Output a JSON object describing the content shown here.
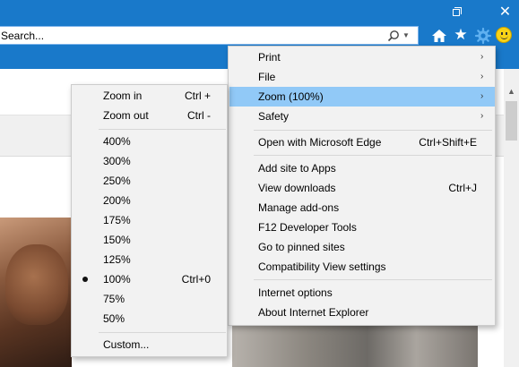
{
  "window": {
    "close_glyph": "✕"
  },
  "address_bar": {
    "value": "Search...",
    "dropdown_glyph": "▼"
  },
  "toolbar": {
    "favorites_glyph": "★",
    "icons": [
      "home-icon",
      "favorites-star-icon",
      "tools-gear-icon",
      "feedback-smiley-icon"
    ]
  },
  "scrollbar": {
    "up_glyph": "▲"
  },
  "tools_menu": {
    "arrow_glyph": "›",
    "items": [
      {
        "label": "Print",
        "shortcut": "",
        "submenu": true
      },
      {
        "label": "File",
        "shortcut": "",
        "submenu": true
      },
      {
        "label": "Zoom (100%)",
        "shortcut": "",
        "submenu": true,
        "highlighted": true
      },
      {
        "label": "Safety",
        "shortcut": "",
        "submenu": true
      },
      {
        "label": "Open with Microsoft Edge",
        "shortcut": "Ctrl+Shift+E"
      },
      {
        "label": "Add site to Apps",
        "shortcut": ""
      },
      {
        "label": "View downloads",
        "shortcut": "Ctrl+J"
      },
      {
        "label": "Manage add-ons",
        "shortcut": ""
      },
      {
        "label": "F12 Developer Tools",
        "shortcut": ""
      },
      {
        "label": "Go to pinned sites",
        "shortcut": ""
      },
      {
        "label": "Compatibility View settings",
        "shortcut": ""
      },
      {
        "label": "Internet options",
        "shortcut": ""
      },
      {
        "label": "About Internet Explorer",
        "shortcut": ""
      }
    ]
  },
  "zoom_menu": {
    "zoom_in": {
      "label": "Zoom in",
      "shortcut": "Ctrl +"
    },
    "zoom_out": {
      "label": "Zoom out",
      "shortcut": "Ctrl -"
    },
    "levels": [
      {
        "label": "400%",
        "shortcut": ""
      },
      {
        "label": "300%",
        "shortcut": ""
      },
      {
        "label": "250%",
        "shortcut": ""
      },
      {
        "label": "200%",
        "shortcut": ""
      },
      {
        "label": "175%",
        "shortcut": ""
      },
      {
        "label": "150%",
        "shortcut": ""
      },
      {
        "label": "125%",
        "shortcut": ""
      },
      {
        "label": "100%",
        "shortcut": "Ctrl+0",
        "selected": true
      },
      {
        "label": "75%",
        "shortcut": ""
      },
      {
        "label": "50%",
        "shortcut": ""
      }
    ],
    "custom": {
      "label": "Custom..."
    }
  },
  "colors": {
    "chrome_blue": "#1979ca",
    "menu_background": "#f2f2f2",
    "menu_highlight": "#91c9f7"
  }
}
